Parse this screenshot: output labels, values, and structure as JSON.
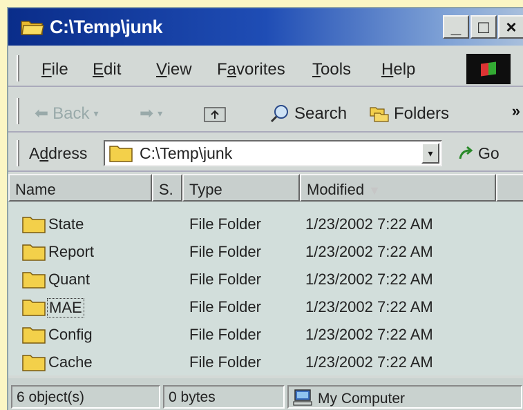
{
  "window": {
    "title": "C:\\Temp\\junk",
    "controls": {
      "minimize": "_",
      "maximize": "□",
      "close": "×"
    }
  },
  "menubar": {
    "items": [
      {
        "label": "File",
        "accel": "F",
        "rest": "ile"
      },
      {
        "label": "Edit",
        "accel": "E",
        "rest": "dit"
      },
      {
        "label": "View",
        "accel": "V",
        "rest": "iew"
      },
      {
        "label": "Favorites",
        "before": "F",
        "accel": "a",
        "rest": "vorites"
      },
      {
        "label": "Tools",
        "accel": "T",
        "rest": "ools"
      },
      {
        "label": "Help",
        "accel": "H",
        "rest": "elp"
      }
    ]
  },
  "toolbar": {
    "back_label": "Back",
    "search_label": "Search",
    "folders_label": "Folders",
    "more": "»"
  },
  "address": {
    "label_before": "A",
    "label_accel": "d",
    "label_after": "dress",
    "value": "C:\\Temp\\junk",
    "go_label": "Go"
  },
  "list": {
    "columns": [
      "Name",
      "S.",
      "Type",
      "Modified"
    ],
    "rows": [
      {
        "name": "State",
        "type": "File Folder",
        "modified": "1/23/2002 7:22 AM"
      },
      {
        "name": "Report",
        "type": "File Folder",
        "modified": "1/23/2002 7:22 AM"
      },
      {
        "name": "Quant",
        "type": "File Folder",
        "modified": "1/23/2002 7:22 AM"
      },
      {
        "name": "MAE",
        "type": "File Folder",
        "modified": "1/23/2002 7:22 AM"
      },
      {
        "name": "Config",
        "type": "File Folder",
        "modified": "1/23/2002 7:22 AM"
      },
      {
        "name": "Cache",
        "type": "File Folder",
        "modified": "1/23/2002 7:22 AM"
      }
    ]
  },
  "statusbar": {
    "objects": "6 object(s)",
    "size": "0 bytes",
    "zone": "My Computer"
  },
  "colors": {
    "title_gradient_start": "#0a2d8a",
    "folder_yellow": "#f6d24a",
    "list_background": "#d2dedb"
  }
}
